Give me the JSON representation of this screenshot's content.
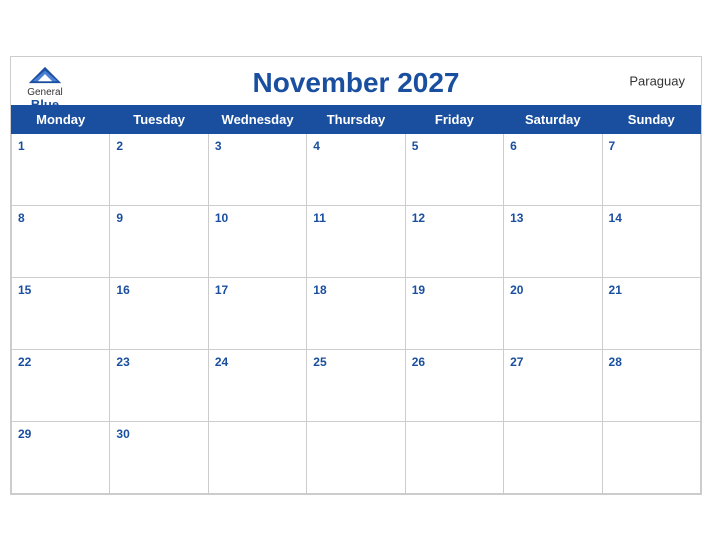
{
  "header": {
    "logo": {
      "general": "General",
      "blue": "Blue",
      "icon": "▲"
    },
    "title": "November 2027",
    "country": "Paraguay"
  },
  "weekdays": [
    "Monday",
    "Tuesday",
    "Wednesday",
    "Thursday",
    "Friday",
    "Saturday",
    "Sunday"
  ],
  "weeks": [
    [
      1,
      2,
      3,
      4,
      5,
      6,
      7
    ],
    [
      8,
      9,
      10,
      11,
      12,
      13,
      14
    ],
    [
      15,
      16,
      17,
      18,
      19,
      20,
      21
    ],
    [
      22,
      23,
      24,
      25,
      26,
      27,
      28
    ],
    [
      29,
      30,
      null,
      null,
      null,
      null,
      null
    ]
  ]
}
